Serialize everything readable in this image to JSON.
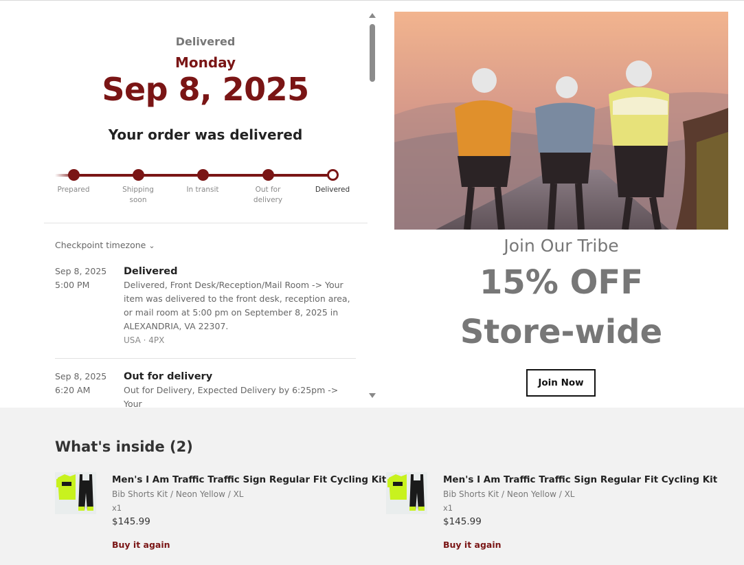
{
  "tracking": {
    "status_heading": "Delivered",
    "weekday": "Monday",
    "date": "Sep 8, 2025",
    "message": "Your order was delivered",
    "steps": [
      {
        "label": "Prepared"
      },
      {
        "label": "Shipping soon"
      },
      {
        "label": "In transit"
      },
      {
        "label": "Out for delivery"
      },
      {
        "label": "Delivered"
      }
    ],
    "timezone_label": "Checkpoint timezone",
    "checkpoints": [
      {
        "date": "Sep 8, 2025",
        "time": "5:00 PM",
        "title": "Delivered",
        "description": "Delivered, Front Desk/Reception/Mail Room -> Your item was delivered to the front desk, reception area, or mail room at 5:00 pm on September 8, 2025 in ALEXANDRIA, VA 22307.",
        "meta": "USA · 4PX"
      },
      {
        "date": "Sep 8, 2025",
        "time": "6:20 AM",
        "title": "Out for delivery",
        "description": "Out for Delivery, Expected Delivery by 6:25pm -> Your"
      }
    ]
  },
  "promo": {
    "tagline": "Join Our Tribe",
    "offer": "15% OFF",
    "scope": "Store-wide",
    "button_label": "Join Now"
  },
  "items_section": {
    "title": "What's inside (2)",
    "items": [
      {
        "name": "Men's I Am Traffic Traffic Sign Regular Fit Cycling Kit",
        "variant": "Bib Shorts Kit / Neon Yellow / XL",
        "qty": "x1",
        "price": "$145.99",
        "action": "Buy it again"
      },
      {
        "name": "Men's I Am Traffic Traffic Sign Regular Fit Cycling Kit",
        "variant": "Bib Shorts Kit / Neon Yellow / XL",
        "qty": "x1",
        "price": "$145.99",
        "action": "Buy it again"
      }
    ]
  },
  "colors": {
    "accent": "#7a1515",
    "muted_text": "#777777",
    "bottom_bg": "#f2f2f2",
    "jersey": "#c8f21e"
  }
}
